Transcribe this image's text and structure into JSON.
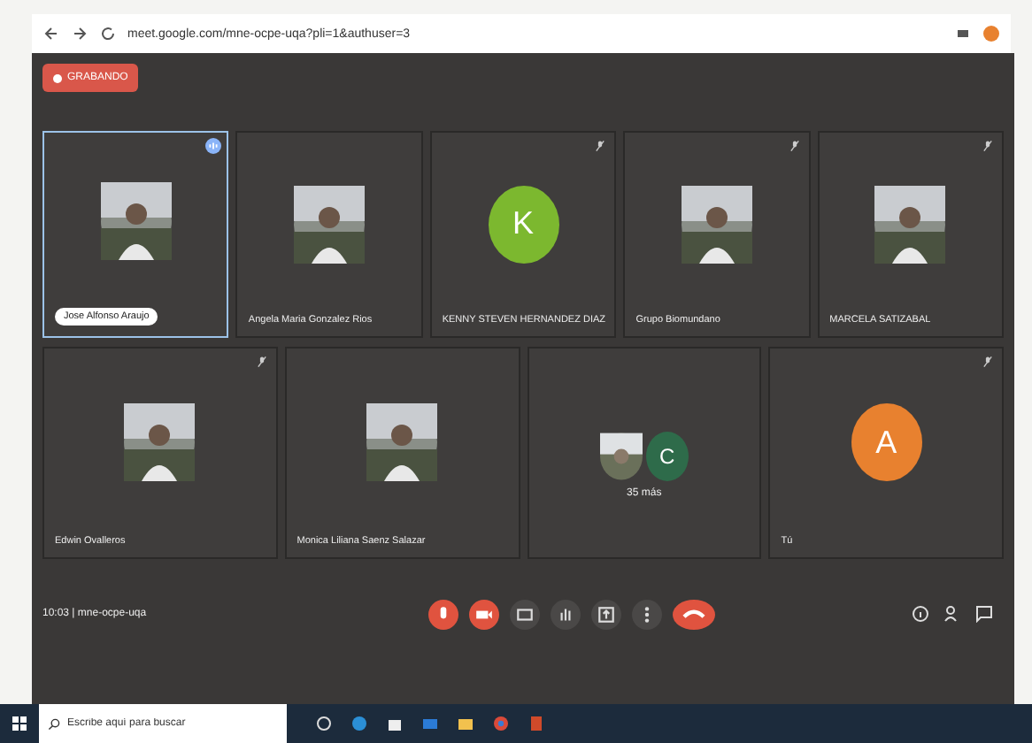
{
  "browser": {
    "url": "meet.google.com/mne-ocpe-uqa?pli=1&authuser=3"
  },
  "recording": {
    "label": "GRABANDO"
  },
  "tile_rows": [
    [
      {
        "name": "Jose Alfonso Araujo",
        "selected": true,
        "speaking": true,
        "muted": false
      },
      {
        "name": "Angela Maria Gonzalez Rios",
        "selected": false,
        "speaking": false,
        "muted": false
      },
      {
        "name": "KENNY STEVEN HERNANDEZ DIAZ",
        "kind": "letter",
        "letter": "K",
        "color": "#7cb82f",
        "selected": false,
        "speaking": false,
        "muted": true
      },
      {
        "name": "Grupo Biomundano",
        "selected": false,
        "speaking": false,
        "muted": true
      },
      {
        "name": "MARCELA SATIZABAL",
        "selected": false,
        "speaking": false,
        "muted": true
      }
    ],
    [
      {
        "name": "Edwin Ovalleros",
        "selected": false,
        "speaking": false,
        "muted": true
      },
      {
        "name": "Monica Liliana Saenz Salazar",
        "selected": false,
        "speaking": false,
        "muted": false
      },
      {
        "name": "35 más",
        "kind": "group",
        "letter": "C",
        "color": "#2e6b4a",
        "selected": false,
        "speaking": false,
        "muted": false
      },
      {
        "name": "Tú",
        "kind": "letter",
        "letter": "A",
        "color": "#e8812f",
        "selected": false,
        "speaking": false,
        "muted": true
      }
    ]
  ],
  "meeting_info": "10:03 | mne-ocpe-uqa",
  "taskbar": {
    "search_placeholder": "Escribe aquí para buscar"
  }
}
